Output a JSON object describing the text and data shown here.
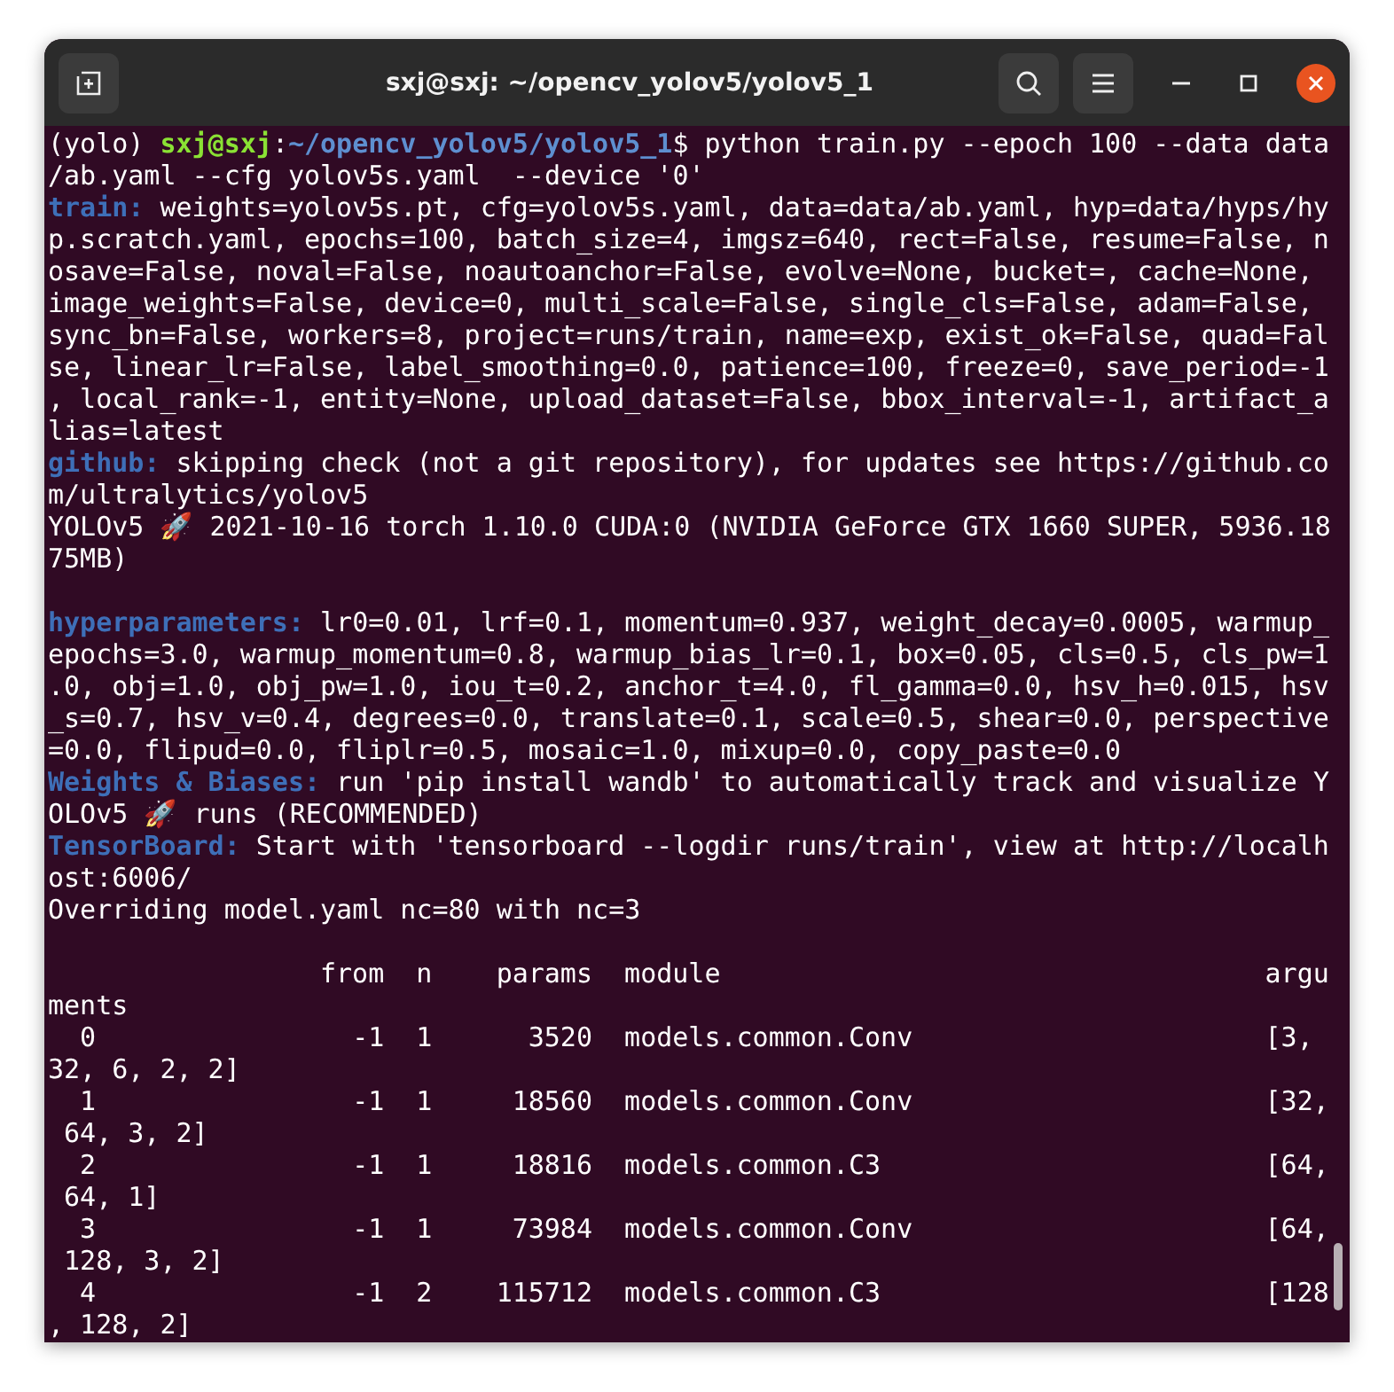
{
  "window": {
    "title": "sxj@sxj: ~/opencv_yolov5/yolov5_1"
  },
  "blocks": [
    {
      "lines": [
        {
          "segments": [
            {
              "kind": "text",
              "text": "(yolo) "
            },
            {
              "kind": "user",
              "text": "sxj@sxj"
            },
            {
              "kind": "text",
              "text": ":"
            },
            {
              "kind": "path",
              "text": "~/opencv_yolov5/yolov5_1"
            },
            {
              "kind": "text",
              "text": "$ python train.py --epoch 100 --data data"
            }
          ]
        },
        {
          "segments": [
            {
              "kind": "text",
              "text": "/ab.yaml --cfg yolov5s.yaml  --device '0'"
            }
          ]
        },
        {
          "segments": [
            {
              "kind": "label",
              "text": "train:"
            },
            {
              "kind": "text",
              "text": " weights=yolov5s.pt, cfg=yolov5s.yaml, data=data/ab.yaml, hyp=data/hyps/hy"
            }
          ]
        },
        {
          "segments": [
            {
              "kind": "text",
              "text": "p.scratch.yaml, epochs=100, batch_size=4, imgsz=640, rect=False, resume=False, n"
            }
          ]
        },
        {
          "segments": [
            {
              "kind": "text",
              "text": "osave=False, noval=False, noautoanchor=False, evolve=None, bucket=, cache=None,"
            }
          ]
        },
        {
          "segments": [
            {
              "kind": "text",
              "text": "image_weights=False, device=0, multi_scale=False, single_cls=False, adam=False,"
            }
          ]
        },
        {
          "segments": [
            {
              "kind": "text",
              "text": "sync_bn=False, workers=8, project=runs/train, name=exp, exist_ok=False, quad=Fal"
            }
          ]
        },
        {
          "segments": [
            {
              "kind": "text",
              "text": "se, linear_lr=False, label_smoothing=0.0, patience=100, freeze=0, save_period=-1"
            }
          ]
        },
        {
          "segments": [
            {
              "kind": "text",
              "text": ", local_rank=-1, entity=None, upload_dataset=False, bbox_interval=-1, artifact_a"
            }
          ]
        },
        {
          "segments": [
            {
              "kind": "text",
              "text": "lias=latest"
            }
          ]
        },
        {
          "segments": [
            {
              "kind": "label",
              "text": "github:"
            },
            {
              "kind": "text",
              "text": " skipping check (not a git repository), for updates see https://github.co"
            }
          ]
        },
        {
          "segments": [
            {
              "kind": "text",
              "text": "m/ultralytics/yolov5"
            }
          ]
        },
        {
          "segments": [
            {
              "kind": "text",
              "text": "YOLOv5 🚀 2021-10-16 torch 1.10.0 CUDA:0 (NVIDIA GeForce GTX 1660 SUPER, 5936.18"
            }
          ]
        },
        {
          "segments": [
            {
              "kind": "text",
              "text": "75MB)"
            }
          ]
        }
      ]
    },
    {
      "lines": [
        {
          "segments": [
            {
              "kind": "label",
              "text": "hyperparameters:"
            },
            {
              "kind": "text",
              "text": " lr0=0.01, lrf=0.1, momentum=0.937, weight_decay=0.0005, warmup_"
            }
          ]
        },
        {
          "segments": [
            {
              "kind": "text",
              "text": "epochs=3.0, warmup_momentum=0.8, warmup_bias_lr=0.1, box=0.05, cls=0.5, cls_pw=1"
            }
          ]
        },
        {
          "segments": [
            {
              "kind": "text",
              "text": ".0, obj=1.0, obj_pw=1.0, iou_t=0.2, anchor_t=4.0, fl_gamma=0.0, hsv_h=0.015, hsv"
            }
          ]
        },
        {
          "segments": [
            {
              "kind": "text",
              "text": "_s=0.7, hsv_v=0.4, degrees=0.0, translate=0.1, scale=0.5, shear=0.0, perspective"
            }
          ]
        },
        {
          "segments": [
            {
              "kind": "text",
              "text": "=0.0, flipud=0.0, fliplr=0.5, mosaic=1.0, mixup=0.0, copy_paste=0.0"
            }
          ]
        },
        {
          "segments": [
            {
              "kind": "label",
              "text": "Weights & Biases:"
            },
            {
              "kind": "text",
              "text": " run 'pip install wandb' to automatically track and visualize Y"
            }
          ]
        },
        {
          "segments": [
            {
              "kind": "text",
              "text": "OLOv5 🚀 runs (RECOMMENDED)"
            }
          ]
        },
        {
          "segments": [
            {
              "kind": "label",
              "text": "TensorBoard:"
            },
            {
              "kind": "text",
              "text": " Start with 'tensorboard --logdir runs/train', view at http://localh"
            }
          ]
        },
        {
          "segments": [
            {
              "kind": "text",
              "text": "ost:6006/"
            }
          ]
        },
        {
          "segments": [
            {
              "kind": "text",
              "text": "Overriding model.yaml nc=80 with nc=3"
            }
          ]
        }
      ]
    }
  ],
  "table": {
    "columns": [
      "from",
      "n",
      "params",
      "module",
      "argu"
    ],
    "column_wrap": "ments",
    "rows": [
      {
        "index": "0",
        "from": "-1",
        "n": "1",
        "params": "3520",
        "module": "models.common.Conv",
        "args": "[3,",
        "args_wrap": "32, 6, 2, 2]"
      },
      {
        "index": "1",
        "from": "-1",
        "n": "1",
        "params": "18560",
        "module": "models.common.Conv",
        "args": "[32,",
        "args_wrap": " 64, 3, 2]"
      },
      {
        "index": "2",
        "from": "-1",
        "n": "1",
        "params": "18816",
        "module": "models.common.C3",
        "args": "[64,",
        "args_wrap": " 64, 1]"
      },
      {
        "index": "3",
        "from": "-1",
        "n": "1",
        "params": "73984",
        "module": "models.common.Conv",
        "args": "[64,",
        "args_wrap": " 128, 3, 2]"
      },
      {
        "index": "4",
        "from": "-1",
        "n": "2",
        "params": "115712",
        "module": "models.common.C3",
        "args": "[128",
        "args_wrap": ", 128, 2]"
      }
    ]
  }
}
